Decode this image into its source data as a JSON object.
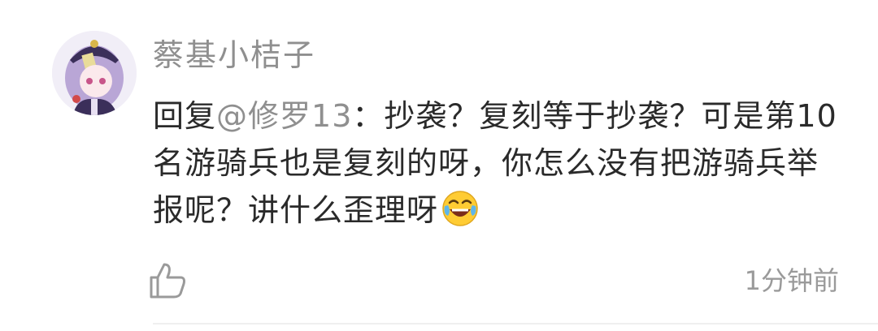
{
  "comment": {
    "username": "蔡基小桔子",
    "reply_prefix": "回复",
    "mention": "@修罗13",
    "separator": "：",
    "text": "抄袭？复刻等于抄袭？可是第10名游骑兵也是复刻的呀，你怎么没有把游骑兵举报呢？讲什么歪理呀",
    "emoji": "laughing-with-tears-emoji",
    "timestamp": "1分钟前"
  },
  "icons": {
    "like": "thumbs-up-icon",
    "avatar": "anime-avatar"
  },
  "colors": {
    "username": "#8f8f8f",
    "mention": "#8f8f8f",
    "body_text": "#2a2a2a",
    "timestamp": "#9a9a9a",
    "emoji_face": "#ffcc33"
  }
}
